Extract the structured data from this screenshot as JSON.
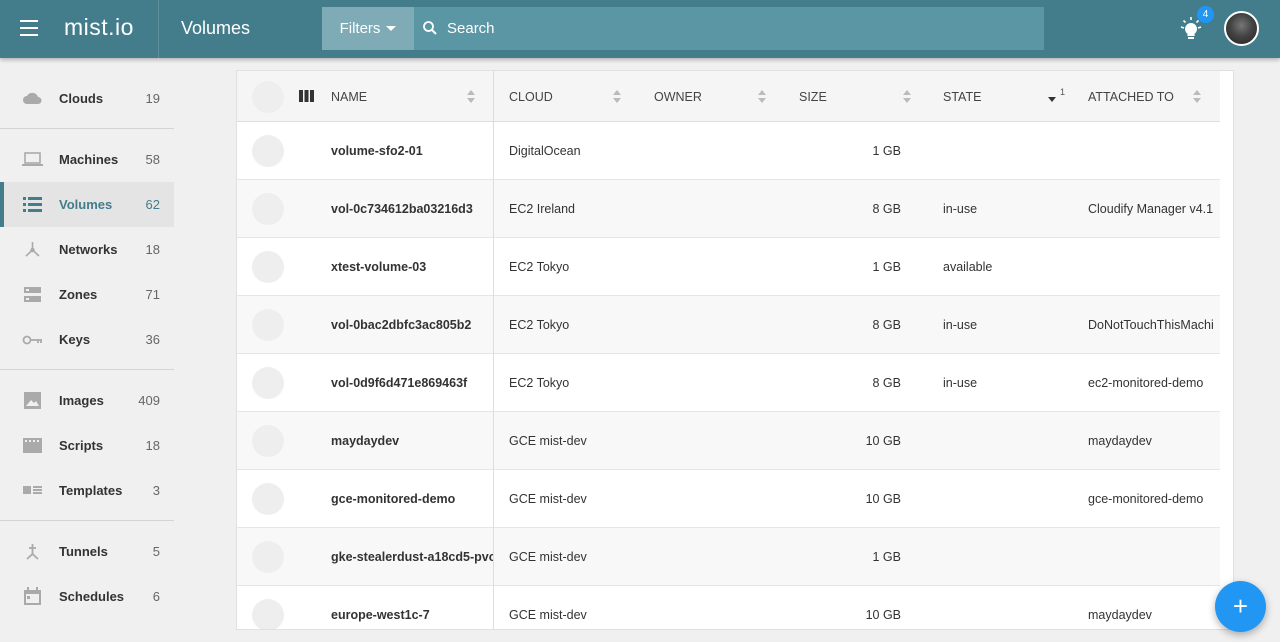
{
  "app": {
    "logo": "mist.io",
    "page_title": "Volumes"
  },
  "search": {
    "filters_label": "Filters",
    "placeholder": "Search",
    "value": ""
  },
  "notifications": {
    "count": "4"
  },
  "sidebar": {
    "items": [
      {
        "label": "Clouds",
        "count": "19",
        "icon": "cloud-icon"
      },
      {
        "label": "Machines",
        "count": "58",
        "icon": "laptop-icon"
      },
      {
        "label": "Volumes",
        "count": "62",
        "icon": "volumes-icon",
        "active": true
      },
      {
        "label": "Networks",
        "count": "18",
        "icon": "network-icon"
      },
      {
        "label": "Zones",
        "count": "71",
        "icon": "zones-icon"
      },
      {
        "label": "Keys",
        "count": "36",
        "icon": "key-icon"
      },
      {
        "label": "Images",
        "count": "409",
        "icon": "image-icon"
      },
      {
        "label": "Scripts",
        "count": "18",
        "icon": "script-icon"
      },
      {
        "label": "Templates",
        "count": "3",
        "icon": "template-icon"
      },
      {
        "label": "Tunnels",
        "count": "5",
        "icon": "tunnel-icon"
      },
      {
        "label": "Schedules",
        "count": "6",
        "icon": "calendar-icon"
      }
    ]
  },
  "table": {
    "columns": {
      "name": "NAME",
      "cloud": "CLOUD",
      "owner": "OWNER",
      "size": "SIZE",
      "state": "STATE",
      "state_sort_index": "1",
      "attached": "ATTACHED TO"
    },
    "rows": [
      {
        "name": "volume-sfo2-01",
        "cloud": "DigitalOcean",
        "owner": "",
        "size": "1 GB",
        "state": "",
        "attached": ""
      },
      {
        "name": "vol-0c734612ba03216d3",
        "cloud": "EC2 Ireland",
        "owner": "",
        "size": "8 GB",
        "state": "in-use",
        "attached": "Cloudify Manager v4.1"
      },
      {
        "name": "xtest-volume-03",
        "cloud": "EC2 Tokyo",
        "owner": "",
        "size": "1 GB",
        "state": "available",
        "attached": ""
      },
      {
        "name": "vol-0bac2dbfc3ac805b2",
        "cloud": "EC2 Tokyo",
        "owner": "",
        "size": "8 GB",
        "state": "in-use",
        "attached": "DoNotTouchThisMachi"
      },
      {
        "name": "vol-0d9f6d471e869463f",
        "cloud": "EC2 Tokyo",
        "owner": "",
        "size": "8 GB",
        "state": "in-use",
        "attached": "ec2-monitored-demo"
      },
      {
        "name": "maydaydev",
        "cloud": "GCE mist-dev",
        "owner": "",
        "size": "10 GB",
        "state": "",
        "attached": "maydaydev"
      },
      {
        "name": "gce-monitored-demo",
        "cloud": "GCE mist-dev",
        "owner": "",
        "size": "10 GB",
        "state": "",
        "attached": "gce-monitored-demo"
      },
      {
        "name": "gke-stealerdust-a18cd5-pvc-",
        "cloud": "GCE mist-dev",
        "owner": "",
        "size": "1 GB",
        "state": "",
        "attached": ""
      },
      {
        "name": "europe-west1c-7",
        "cloud": "GCE mist-dev",
        "owner": "",
        "size": "10 GB",
        "state": "",
        "attached": "maydaydev"
      }
    ]
  },
  "fab": {
    "label": "+"
  },
  "colors": {
    "header": "#437d8b",
    "accent": "#2196f3"
  }
}
